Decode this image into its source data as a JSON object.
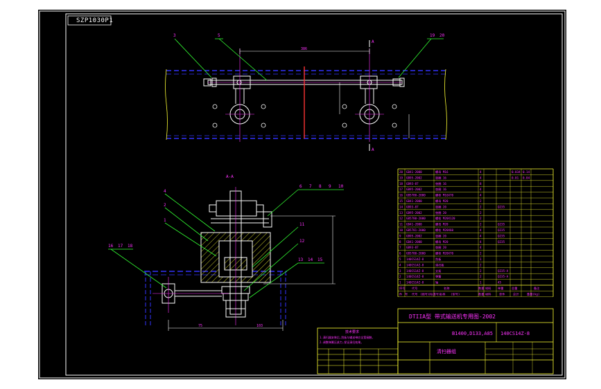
{
  "drawing_number": "SZP1030P1",
  "section_label": "A-A",
  "section_mark": "A",
  "dimensions": {
    "top_span": "386",
    "bottom_left": "75",
    "bottom_right": "103"
  },
  "callouts_top": [
    "3",
    "5",
    "19",
    "20"
  ],
  "callouts_bottom": [
    "4",
    "2",
    "1",
    "6",
    "7",
    "8",
    "9",
    "10",
    "11",
    "12",
    "13",
    "14",
    "15",
    "16",
    "17",
    "18"
  ],
  "title_block": {
    "project": "DTIIA型 带式输送机专用图-2002",
    "spec": "B1400,D133,A85",
    "drawing_code": "140CS14Z-8",
    "drawing_name": "清扫器组",
    "header_cols": [
      "序号",
      "代号",
      "名称",
      "数量",
      "材料",
      "单重",
      "总重",
      "备注"
    ],
    "bottom_labels": [
      "件",
      "号",
      "代号",
      "(图号)",
      "(标准号)",
      "名称",
      "(型号)",
      "数量",
      "材料",
      "单件",
      "总计",
      "重量(kg)"
    ]
  },
  "parts_list_rows": [
    {
      "no": "20",
      "code": "GB41-2000",
      "name": "螺母 M16",
      "qty": "4",
      "mat": "",
      "unit": "0.034",
      "total": "0.14"
    },
    {
      "no": "19",
      "code": "GB95-2002",
      "name": "垫圈 16",
      "qty": "4",
      "mat": "",
      "unit": "0.01",
      "total": "0.04"
    },
    {
      "no": "18",
      "code": "GB93-87",
      "name": "垫圈 16",
      "qty": "8",
      "mat": "",
      "unit": "",
      "total": ""
    },
    {
      "no": "17",
      "code": "GB95-2002",
      "name": "垫圈 16",
      "qty": "4",
      "mat": "",
      "unit": "",
      "total": ""
    },
    {
      "no": "16",
      "code": "GB5780-2000",
      "name": "螺栓 M16X70",
      "qty": "4",
      "mat": "",
      "unit": "",
      "total": ""
    },
    {
      "no": "15",
      "code": "GB41-2000",
      "name": "螺母 M20",
      "qty": "2",
      "mat": "",
      "unit": "",
      "total": ""
    },
    {
      "no": "14",
      "code": "GB93-87",
      "name": "垫圈 20",
      "qty": "2",
      "mat": "Q235",
      "unit": "",
      "total": ""
    },
    {
      "no": "13",
      "code": "GB95-2002",
      "name": "垫圈 20",
      "qty": "2",
      "mat": "",
      "unit": "",
      "total": ""
    },
    {
      "no": "12",
      "code": "GB5780-2000",
      "name": "螺栓 M20X120",
      "qty": "2",
      "mat": "",
      "unit": "",
      "total": ""
    },
    {
      "no": "11",
      "code": "GB41-2000",
      "name": "螺母 M20",
      "qty": "2",
      "mat": "Q235",
      "unit": "",
      "total": ""
    },
    {
      "no": "10",
      "code": "GB5781-2000",
      "name": "螺栓 M20X60",
      "qty": "4",
      "mat": "Q235",
      "unit": "",
      "total": ""
    },
    {
      "no": "9",
      "code": "GB95-2002",
      "name": "垫圈 20",
      "qty": "4",
      "mat": "Q235",
      "unit": "",
      "total": ""
    },
    {
      "no": "8",
      "code": "GB41-2000",
      "name": "螺母 M20",
      "qty": "4",
      "mat": "Q235",
      "unit": "",
      "total": ""
    },
    {
      "no": "7",
      "code": "GB93-87",
      "name": "垫圈 20",
      "qty": "4",
      "mat": "",
      "unit": "",
      "total": ""
    },
    {
      "no": "6",
      "code": "GB5780-2000",
      "name": "螺栓 M20X70",
      "qty": "2",
      "mat": "",
      "unit": "",
      "total": ""
    },
    {
      "no": "5",
      "code": "140CS14Z-8",
      "name": "刮板",
      "qty": "1",
      "mat": "",
      "unit": "",
      "total": ""
    },
    {
      "no": "4",
      "code": "140CS14Z-8",
      "name": "清扫板",
      "qty": "2",
      "mat": "",
      "unit": "",
      "total": ""
    },
    {
      "no": "3",
      "code": "140CS14Z-8",
      "name": "支架",
      "qty": "2",
      "mat": "Q235-A",
      "unit": "",
      "total": ""
    },
    {
      "no": "2",
      "code": "140CS14Z-8",
      "name": "弹簧",
      "qty": "2",
      "mat": "Q235-A",
      "unit": "",
      "total": ""
    },
    {
      "no": "1",
      "code": "140CS14Z-8",
      "name": "轴",
      "qty": "1",
      "mat": "45",
      "unit": "",
      "total": ""
    }
  ],
  "notes": {
    "title": "技术要求",
    "lines": [
      "1.清扫器安装后,刮板与输送带应全宽接触,",
      "2.调整弹簧压紧力,保证清扫效果。"
    ]
  },
  "colors": {
    "background": "#000000",
    "outline": "#ffffff",
    "centerline": "#ff33ff",
    "hidden": "#3333ff",
    "leader": "#33ff33",
    "hatch": "#ffff33",
    "cut": "#ff3333",
    "table_line": "#ffff33"
  }
}
